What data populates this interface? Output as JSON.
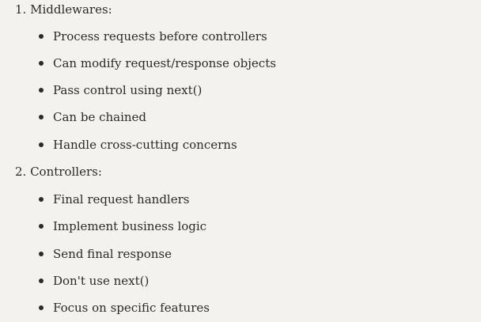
{
  "sections": [
    {
      "title": "1. Middlewares:",
      "items": [
        "Process requests before controllers",
        "Can modify request/response objects",
        "Pass control using next()",
        "Can be chained",
        "Handle cross-cutting concerns"
      ]
    },
    {
      "title": "2. Controllers:",
      "items": [
        "Final request handlers",
        "Implement business logic",
        "Send final response",
        "Don't use next()",
        "Focus on specific features"
      ]
    }
  ]
}
